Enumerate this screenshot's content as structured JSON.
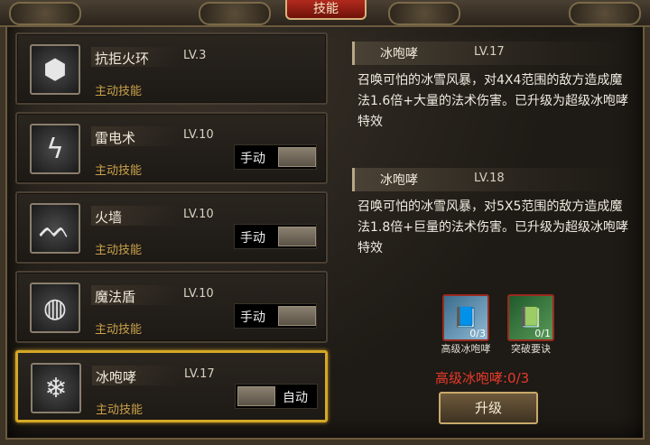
{
  "window": {
    "title": "技能"
  },
  "skills": [
    {
      "name": "抗拒火环",
      "level": "LV.3",
      "type": "主动技能",
      "icon": "fire-ring-icon",
      "glyph": "⬢",
      "mode": ""
    },
    {
      "name": "雷电术",
      "level": "LV.10",
      "type": "主动技能",
      "icon": "lightning-icon",
      "glyph": "ϟ",
      "mode": "手动"
    },
    {
      "name": "火墙",
      "level": "LV.10",
      "type": "主动技能",
      "icon": "fire-wall-icon",
      "glyph": "ᨓ",
      "mode": "手动"
    },
    {
      "name": "魔法盾",
      "level": "LV.10",
      "type": "主动技能",
      "icon": "magic-shield-icon",
      "glyph": "◍",
      "mode": "手动"
    },
    {
      "name": "冰咆哮",
      "level": "LV.17",
      "type": "主动技能",
      "icon": "snowflake-icon",
      "glyph": "❄",
      "mode": "自动"
    }
  ],
  "detail": {
    "current": {
      "name": "冰咆哮",
      "level": "LV.17",
      "description": "召唤可怕的冰雪风暴，对4X4范围的敌方造成魔法1.6倍+大量的法术伤害。已升级为超级冰咆哮特效"
    },
    "next": {
      "name": "冰咆哮",
      "level": "LV.18",
      "description": "召唤可怕的冰雪风暴，对5X5范围的敌方造成魔法1.8倍+巨量的法术伤害。已升级为超级冰咆哮特效"
    },
    "materials": [
      {
        "label": "高级冰咆哮",
        "count": "0/3",
        "icon": "ice-book-icon",
        "glyph": "📘"
      },
      {
        "label": "突破要诀",
        "count": "0/1",
        "icon": "breakthrough-book-icon",
        "glyph": "📗"
      }
    ],
    "upgrade_status": "高级冰咆哮:0/3",
    "upgrade_label": "升级"
  },
  "colors": {
    "accent_gold": "#d4a827",
    "warning_red": "#e63a2a",
    "skill_type": "#c9a24a"
  }
}
